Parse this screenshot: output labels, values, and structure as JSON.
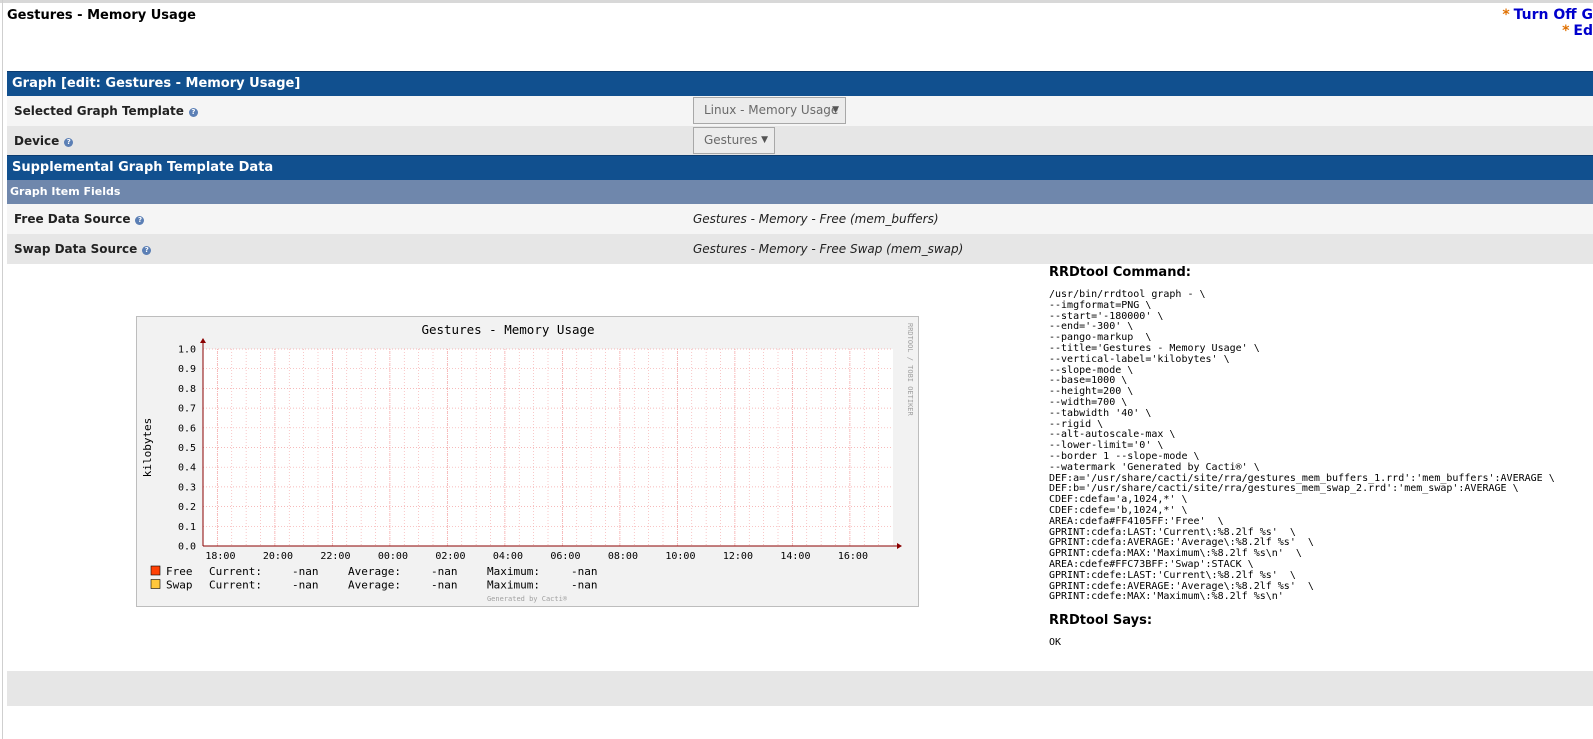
{
  "page": {
    "title": "Gestures - Memory Usage"
  },
  "top_links": [
    "Turn Off G",
    "Ed"
  ],
  "graph_section": {
    "header": "Graph [edit: Gestures - Memory Usage]",
    "template_label": "Selected Graph Template",
    "template_value": "Linux - Memory Usage",
    "device_label": "Device",
    "device_value": "Gestures"
  },
  "supplemental": {
    "header": "Supplemental Graph Template Data",
    "subheader": "Graph Item Fields",
    "fields": [
      {
        "label": "Free Data Source",
        "value": "Gestures - Memory - Free (mem_buffers)"
      },
      {
        "label": "Swap Data Source",
        "value": "Gestures - Memory - Free Swap (mem_swap)"
      }
    ]
  },
  "rrdtool": {
    "command_heading": "RRDtool Command:",
    "command_lines": [
      "/usr/bin/rrdtool graph - \\",
      "--imgformat=PNG \\",
      "--start='-180000' \\",
      "--end='-300' \\",
      "--pango-markup  \\",
      "--title='Gestures - Memory Usage' \\",
      "--vertical-label='kilobytes' \\",
      "--slope-mode \\",
      "--base=1000 \\",
      "--height=200 \\",
      "--width=700 \\",
      "--tabwidth '40' \\",
      "--rigid \\",
      "--alt-autoscale-max \\",
      "--lower-limit='0' \\",
      "--border 1 --slope-mode \\",
      "--watermark 'Generated by Cacti®' \\",
      "DEF:a='/usr/share/cacti/site/rra/gestures_mem_buffers_1.rrd':'mem_buffers':AVERAGE \\",
      "DEF:b='/usr/share/cacti/site/rra/gestures_mem_swap_2.rrd':'mem_swap':AVERAGE \\",
      "CDEF:cdefa='a,1024,*' \\",
      "CDEF:cdefe='b,1024,*' \\",
      "AREA:cdefa#FF4105FF:'Free'  \\",
      "GPRINT:cdefa:LAST:'Current\\:%8.2lf %s'  \\",
      "GPRINT:cdefa:AVERAGE:'Average\\:%8.2lf %s'  \\",
      "GPRINT:cdefa:MAX:'Maximum\\:%8.2lf %s\\n'  \\",
      "AREA:cdefe#FFC73BFF:'Swap':STACK \\",
      "GPRINT:cdefe:LAST:'Current\\:%8.2lf %s'  \\",
      "GPRINT:cdefe:AVERAGE:'Average\\:%8.2lf %s'  \\",
      "GPRINT:cdefe:MAX:'Maximum\\:%8.2lf %s\\n'"
    ],
    "says_heading": "RRDtool Says:",
    "says_value": "OK"
  },
  "chart_data": {
    "type": "area",
    "title": "Gestures - Memory Usage",
    "ylabel": "kilobytes",
    "xlabel": "",
    "ylim": [
      0,
      1.0
    ],
    "y_ticks": [
      "0.0",
      "0.1",
      "0.2",
      "0.3",
      "0.4",
      "0.5",
      "0.6",
      "0.7",
      "0.8",
      "0.9",
      "1.0"
    ],
    "x_ticks": [
      "18:00",
      "20:00",
      "22:00",
      "00:00",
      "02:00",
      "04:00",
      "06:00",
      "08:00",
      "10:00",
      "12:00",
      "14:00",
      "16:00"
    ],
    "grid": true,
    "series": [
      {
        "name": "Free",
        "color": "#FF4105",
        "values": [],
        "current": "-nan",
        "average": "-nan",
        "maximum": "-nan"
      },
      {
        "name": "Swap",
        "color": "#FFC73B",
        "values": [],
        "current": "-nan",
        "average": "-nan",
        "maximum": "-nan"
      }
    ],
    "legend_labels": {
      "current": "Current:",
      "average": "Average:",
      "maximum": "Maximum:"
    },
    "side_text": "RRDTOOL / TOBI OETIKER",
    "watermark": "Generated by Cacti®",
    "colors": {
      "background": "#F2F2F2",
      "grid": "#F4A4A4",
      "axis": "#8B0000"
    }
  }
}
